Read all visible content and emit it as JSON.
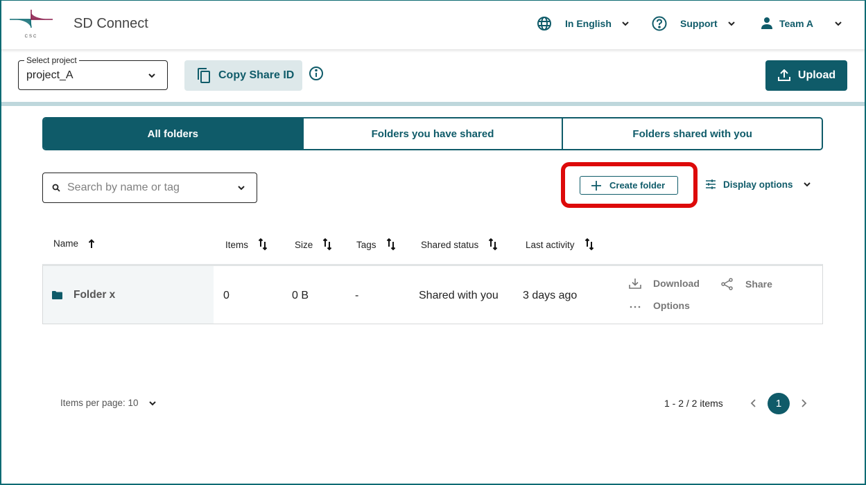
{
  "header": {
    "app_title": "SD Connect",
    "logo_text": "CSC",
    "language": {
      "label": "In English",
      "icon": "globe-icon"
    },
    "support": {
      "label": "Support",
      "icon": "help-circle-icon"
    },
    "user": {
      "label": "Team A",
      "icon": "user-icon"
    }
  },
  "toolbar": {
    "project_select": {
      "legend": "Select project",
      "value": "project_A"
    },
    "copy_share_id_label": "Copy Share ID",
    "upload_label": "Upload"
  },
  "tabs": [
    {
      "label": "All folders",
      "active": true
    },
    {
      "label": "Folders you have shared",
      "active": false
    },
    {
      "label": "Folders shared with you",
      "active": false
    }
  ],
  "search": {
    "placeholder": "Search by name or tag"
  },
  "actions": {
    "create_folder_label": "Create folder",
    "display_options_label": "Display options"
  },
  "table": {
    "columns": [
      {
        "label": "Name",
        "sort": "ascending"
      },
      {
        "label": "Items",
        "sort": "none"
      },
      {
        "label": "Size",
        "sort": "none"
      },
      {
        "label": "Tags",
        "sort": "none"
      },
      {
        "label": "Shared status",
        "sort": "none"
      },
      {
        "label": "Last activity",
        "sort": "none"
      }
    ],
    "rows": [
      {
        "name": "Folder x",
        "items": "0",
        "size": "0 B",
        "tags": "-",
        "shared_status": "Shared with you",
        "last_activity": "3 days ago",
        "row_actions": {
          "download": "Download",
          "share": "Share",
          "options": "Options"
        }
      }
    ]
  },
  "pagination": {
    "items_per_page_label": "Items per page: 10",
    "range_label": "1 - 2 / 2 items",
    "current_page": "1"
  },
  "colors": {
    "brand": "#0f5b69",
    "highlight": "#dd0a0a",
    "tab_band": "#bed7dc"
  }
}
